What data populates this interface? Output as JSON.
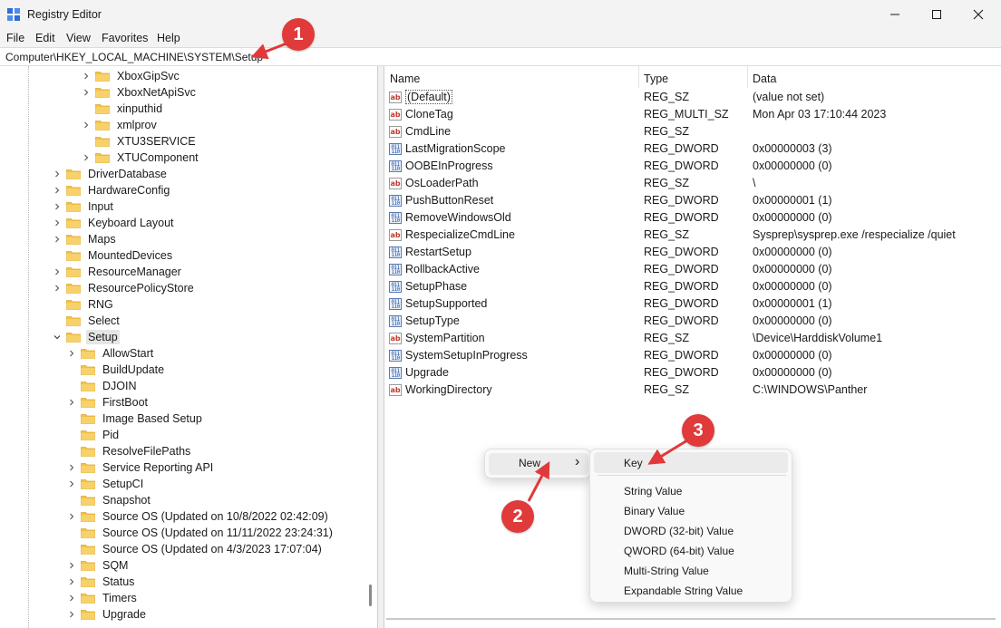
{
  "window": {
    "title": "Registry Editor"
  },
  "menu": {
    "file": "File",
    "edit": "Edit",
    "view": "View",
    "favorites": "Favorites",
    "help": "Help"
  },
  "address": "Computer\\HKEY_LOCAL_MACHINE\\SYSTEM\\Setup",
  "tree": [
    {
      "label": "XboxGipSvc",
      "expander": "collapsed"
    },
    {
      "label": "XboxNetApiSvc",
      "expander": "collapsed"
    },
    {
      "label": "xinputhid",
      "expander": "none"
    },
    {
      "label": "xmlprov",
      "expander": "collapsed"
    },
    {
      "label": "XTU3SERVICE",
      "expander": "none"
    },
    {
      "label": "XTUComponent",
      "expander": "collapsed"
    },
    {
      "label": "DriverDatabase",
      "expander": "collapsed"
    },
    {
      "label": "HardwareConfig",
      "expander": "collapsed"
    },
    {
      "label": "Input",
      "expander": "collapsed"
    },
    {
      "label": "Keyboard Layout",
      "expander": "collapsed"
    },
    {
      "label": "Maps",
      "expander": "collapsed"
    },
    {
      "label": "MountedDevices",
      "expander": "none"
    },
    {
      "label": "ResourceManager",
      "expander": "collapsed"
    },
    {
      "label": "ResourcePolicyStore",
      "expander": "collapsed"
    },
    {
      "label": "RNG",
      "expander": "none"
    },
    {
      "label": "Select",
      "expander": "none"
    },
    {
      "label": "Setup",
      "expander": "expanded"
    },
    {
      "label": "AllowStart",
      "expander": "collapsed"
    },
    {
      "label": "BuildUpdate",
      "expander": "none"
    },
    {
      "label": "DJOIN",
      "expander": "none"
    },
    {
      "label": "FirstBoot",
      "expander": "collapsed"
    },
    {
      "label": "Image Based Setup",
      "expander": "none"
    },
    {
      "label": "Pid",
      "expander": "none"
    },
    {
      "label": "ResolveFilePaths",
      "expander": "none"
    },
    {
      "label": "Service Reporting API",
      "expander": "collapsed"
    },
    {
      "label": "SetupCI",
      "expander": "collapsed"
    },
    {
      "label": "Snapshot",
      "expander": "none"
    },
    {
      "label": "Source OS (Updated on 10/8/2022 02:42:09)",
      "expander": "collapsed"
    },
    {
      "label": "Source OS (Updated on 11/11/2022 23:24:31)",
      "expander": "none"
    },
    {
      "label": "Source OS (Updated on 4/3/2023 17:07:04)",
      "expander": "none"
    },
    {
      "label": "SQM",
      "expander": "collapsed"
    },
    {
      "label": "Status",
      "expander": "collapsed"
    },
    {
      "label": "Timers",
      "expander": "collapsed"
    },
    {
      "label": "Upgrade",
      "expander": "collapsed"
    }
  ],
  "columns": {
    "name": "Name",
    "type": "Type",
    "data": "Data"
  },
  "values": [
    {
      "icon": "ab",
      "name": "(Default)",
      "type": "REG_SZ",
      "data": "(value not set)"
    },
    {
      "icon": "ab",
      "name": "CloneTag",
      "type": "REG_MULTI_SZ",
      "data": "Mon Apr 03 17:10:44 2023"
    },
    {
      "icon": "ab",
      "name": "CmdLine",
      "type": "REG_SZ",
      "data": ""
    },
    {
      "icon": "bin",
      "name": "LastMigrationScope",
      "type": "REG_DWORD",
      "data": "0x00000003 (3)"
    },
    {
      "icon": "bin",
      "name": "OOBEInProgress",
      "type": "REG_DWORD",
      "data": "0x00000000 (0)"
    },
    {
      "icon": "ab",
      "name": "OsLoaderPath",
      "type": "REG_SZ",
      "data": "\\"
    },
    {
      "icon": "bin",
      "name": "PushButtonReset",
      "type": "REG_DWORD",
      "data": "0x00000001 (1)"
    },
    {
      "icon": "bin",
      "name": "RemoveWindowsOld",
      "type": "REG_DWORD",
      "data": "0x00000000 (0)"
    },
    {
      "icon": "ab",
      "name": "RespecializeCmdLine",
      "type": "REG_SZ",
      "data": "Sysprep\\sysprep.exe /respecialize /quiet"
    },
    {
      "icon": "bin",
      "name": "RestartSetup",
      "type": "REG_DWORD",
      "data": "0x00000000 (0)"
    },
    {
      "icon": "bin",
      "name": "RollbackActive",
      "type": "REG_DWORD",
      "data": "0x00000000 (0)"
    },
    {
      "icon": "bin",
      "name": "SetupPhase",
      "type": "REG_DWORD",
      "data": "0x00000000 (0)"
    },
    {
      "icon": "bin",
      "name": "SetupSupported",
      "type": "REG_DWORD",
      "data": "0x00000001 (1)"
    },
    {
      "icon": "bin",
      "name": "SetupType",
      "type": "REG_DWORD",
      "data": "0x00000000 (0)"
    },
    {
      "icon": "ab",
      "name": "SystemPartition",
      "type": "REG_SZ",
      "data": "\\Device\\HarddiskVolume1"
    },
    {
      "icon": "bin",
      "name": "SystemSetupInProgress",
      "type": "REG_DWORD",
      "data": "0x00000000 (0)"
    },
    {
      "icon": "bin",
      "name": "Upgrade",
      "type": "REG_DWORD",
      "data": "0x00000000 (0)"
    },
    {
      "icon": "ab",
      "name": "WorkingDirectory",
      "type": "REG_SZ",
      "data": "C:\\WINDOWS\\Panther"
    }
  ],
  "context_menu": {
    "new": "New",
    "submenu_arrow": "›"
  },
  "submenu": {
    "key": "Key",
    "items": [
      "String Value",
      "Binary Value",
      "DWORD (32-bit) Value",
      "QWORD (64-bit) Value",
      "Multi-String Value",
      "Expandable String Value"
    ]
  },
  "callouts": [
    "1",
    "2",
    "3"
  ],
  "colors": {
    "folder": "#f2c24a",
    "folder_dark": "#e0a92e",
    "callout": "#e03a3a"
  }
}
